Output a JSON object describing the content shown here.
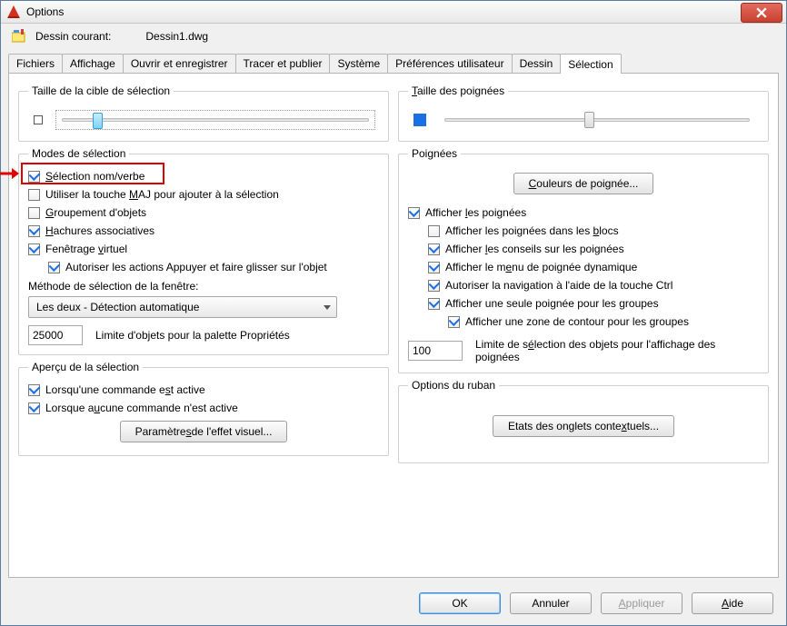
{
  "window": {
    "title": "Options"
  },
  "subheader": {
    "label": "Dessin courant:",
    "value": "Dessin1.dwg"
  },
  "tabs": [
    {
      "label": "Fichiers"
    },
    {
      "label": "Affichage"
    },
    {
      "label": "Ouvrir et enregistrer"
    },
    {
      "label": "Tracer et publier"
    },
    {
      "label": "Système"
    },
    {
      "label": "Préférences utilisateur"
    },
    {
      "label": "Dessin"
    },
    {
      "label": "Sélection"
    }
  ],
  "left": {
    "pickbox_legend": "Taille de la cible de sélection",
    "modes_legend": "Modes de sélection",
    "modes": {
      "noun_verb": "Sélection nom/verbe",
      "shift_add_pre": "Utiliser la touche ",
      "shift_add_u": "M",
      "shift_add_post": "AJ pour ajouter à la sélection",
      "group_u": "G",
      "group_rest": "roupement d'objets",
      "hatch_u": "H",
      "hatch_rest": "achures associatives",
      "window_pre": "Fenêtrage ",
      "window_u": "v",
      "window_post": "irtuel",
      "pressdrag": "Autoriser les actions Appuyer et faire glisser sur l'objet",
      "method_label": "Méthode de sélection de la fenêtre:",
      "method_value": "Les deux - Détection automatique",
      "limit_value": "25000",
      "limit_label": "Limite d'objets pour la palette Propriétés"
    },
    "preview_legend": "Aperçu de la sélection",
    "preview": {
      "cmd_active_pre": "Lorsqu'une commande e",
      "cmd_active_u": "s",
      "cmd_active_post": "t active",
      "nocmd_active_pre": "Lorsque a",
      "nocmd_active_u": "u",
      "nocmd_active_post": "cune commande n'est active",
      "btn_pre": "Paramètre",
      "btn_u": "s",
      "btn_post": " de l'effet visuel..."
    }
  },
  "right": {
    "gripsize_legend_u": "T",
    "gripsize_legend_rest": "aille des poignées",
    "grips_legend": "Poignées",
    "grips": {
      "colors_btn_u": "C",
      "colors_btn_rest": "ouleurs de poignée...",
      "show_pre": "Afficher ",
      "show_u": "l",
      "show_post": "es poignées",
      "blocks_pre": "Afficher les poignées dans les ",
      "blocks_u": "b",
      "blocks_post": "locs",
      "tips_pre": "Afficher ",
      "tips_u": "l",
      "tips_post": "es conseils sur les poignées",
      "dynmenu_pre": "Afficher le m",
      "dynmenu_u": "e",
      "dynmenu_post": "nu de poignée dynamique",
      "ctrlnav": "Autoriser la navigation à l'aide de la touche Ctrl",
      "single_group": "Afficher une seule poignée pour les groupes",
      "bbox_group": "Afficher une zone de contour pour les groupes",
      "limit_value": "100",
      "limit_label_pre": "Limite de s",
      "limit_label_u": "é",
      "limit_label_post": "lection des objets pour l'affichage des poignées"
    },
    "ribbon_legend": "Options du ruban",
    "ribbon_btn_pre": "Etats des onglets conte",
    "ribbon_btn_u": "x",
    "ribbon_btn_post": "tuels..."
  },
  "buttons": {
    "ok": "OK",
    "cancel": "Annuler",
    "apply": "Appliquer",
    "help_u": "A",
    "help_rest": "ide"
  }
}
